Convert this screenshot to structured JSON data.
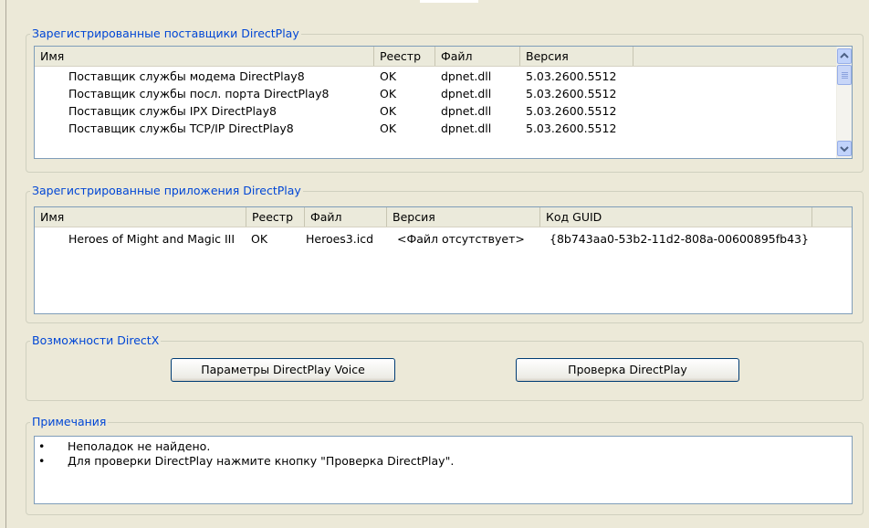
{
  "providers": {
    "title": "Зарегистрированные поставщики DirectPlay",
    "columns": [
      "Имя",
      "Реестр",
      "Файл",
      "Версия"
    ],
    "rows": [
      [
        "Поставщик службы модема DirectPlay8",
        "OK",
        "dpnet.dll",
        "5.03.2600.5512"
      ],
      [
        "Поставщик службы посл. порта DirectPlay8",
        "OK",
        "dpnet.dll",
        "5.03.2600.5512"
      ],
      [
        "Поставщик службы IPX  DirectPlay8",
        "OK",
        "dpnet.dll",
        "5.03.2600.5512"
      ],
      [
        "Поставщик службы TCP/IP DirectPlay8",
        "OK",
        "dpnet.dll",
        "5.03.2600.5512"
      ]
    ],
    "scroll_up_icon": "chevron-up-icon",
    "scroll_down_icon": "chevron-down-icon"
  },
  "applications": {
    "title": "Зарегистрированные приложения DirectPlay",
    "columns": [
      "Имя",
      "Реестр",
      "Файл",
      "Версия",
      "Код GUID"
    ],
    "rows": [
      [
        "Heroes of Might and Magic III",
        "OK",
        "Heroes3.icd",
        "<Файл отсутствует>",
        "{8b743aa0-53b2-11d2-808a-00600895fb43}"
      ]
    ]
  },
  "capabilities": {
    "title": "Возможности DirectX",
    "voice_button": "Параметры DirectPlay Voice",
    "test_button": "Проверка DirectPlay"
  },
  "notes": {
    "title": "Примечания",
    "bullet": "•",
    "lines": [
      "Неполадок не найдено.",
      "Для проверки DirectPlay нажмите кнопку \"Проверка DirectPlay\"."
    ]
  },
  "colors": {
    "group_title": "#0046d5",
    "window_bg": "#ece9d8",
    "border": "#7f9db9"
  }
}
